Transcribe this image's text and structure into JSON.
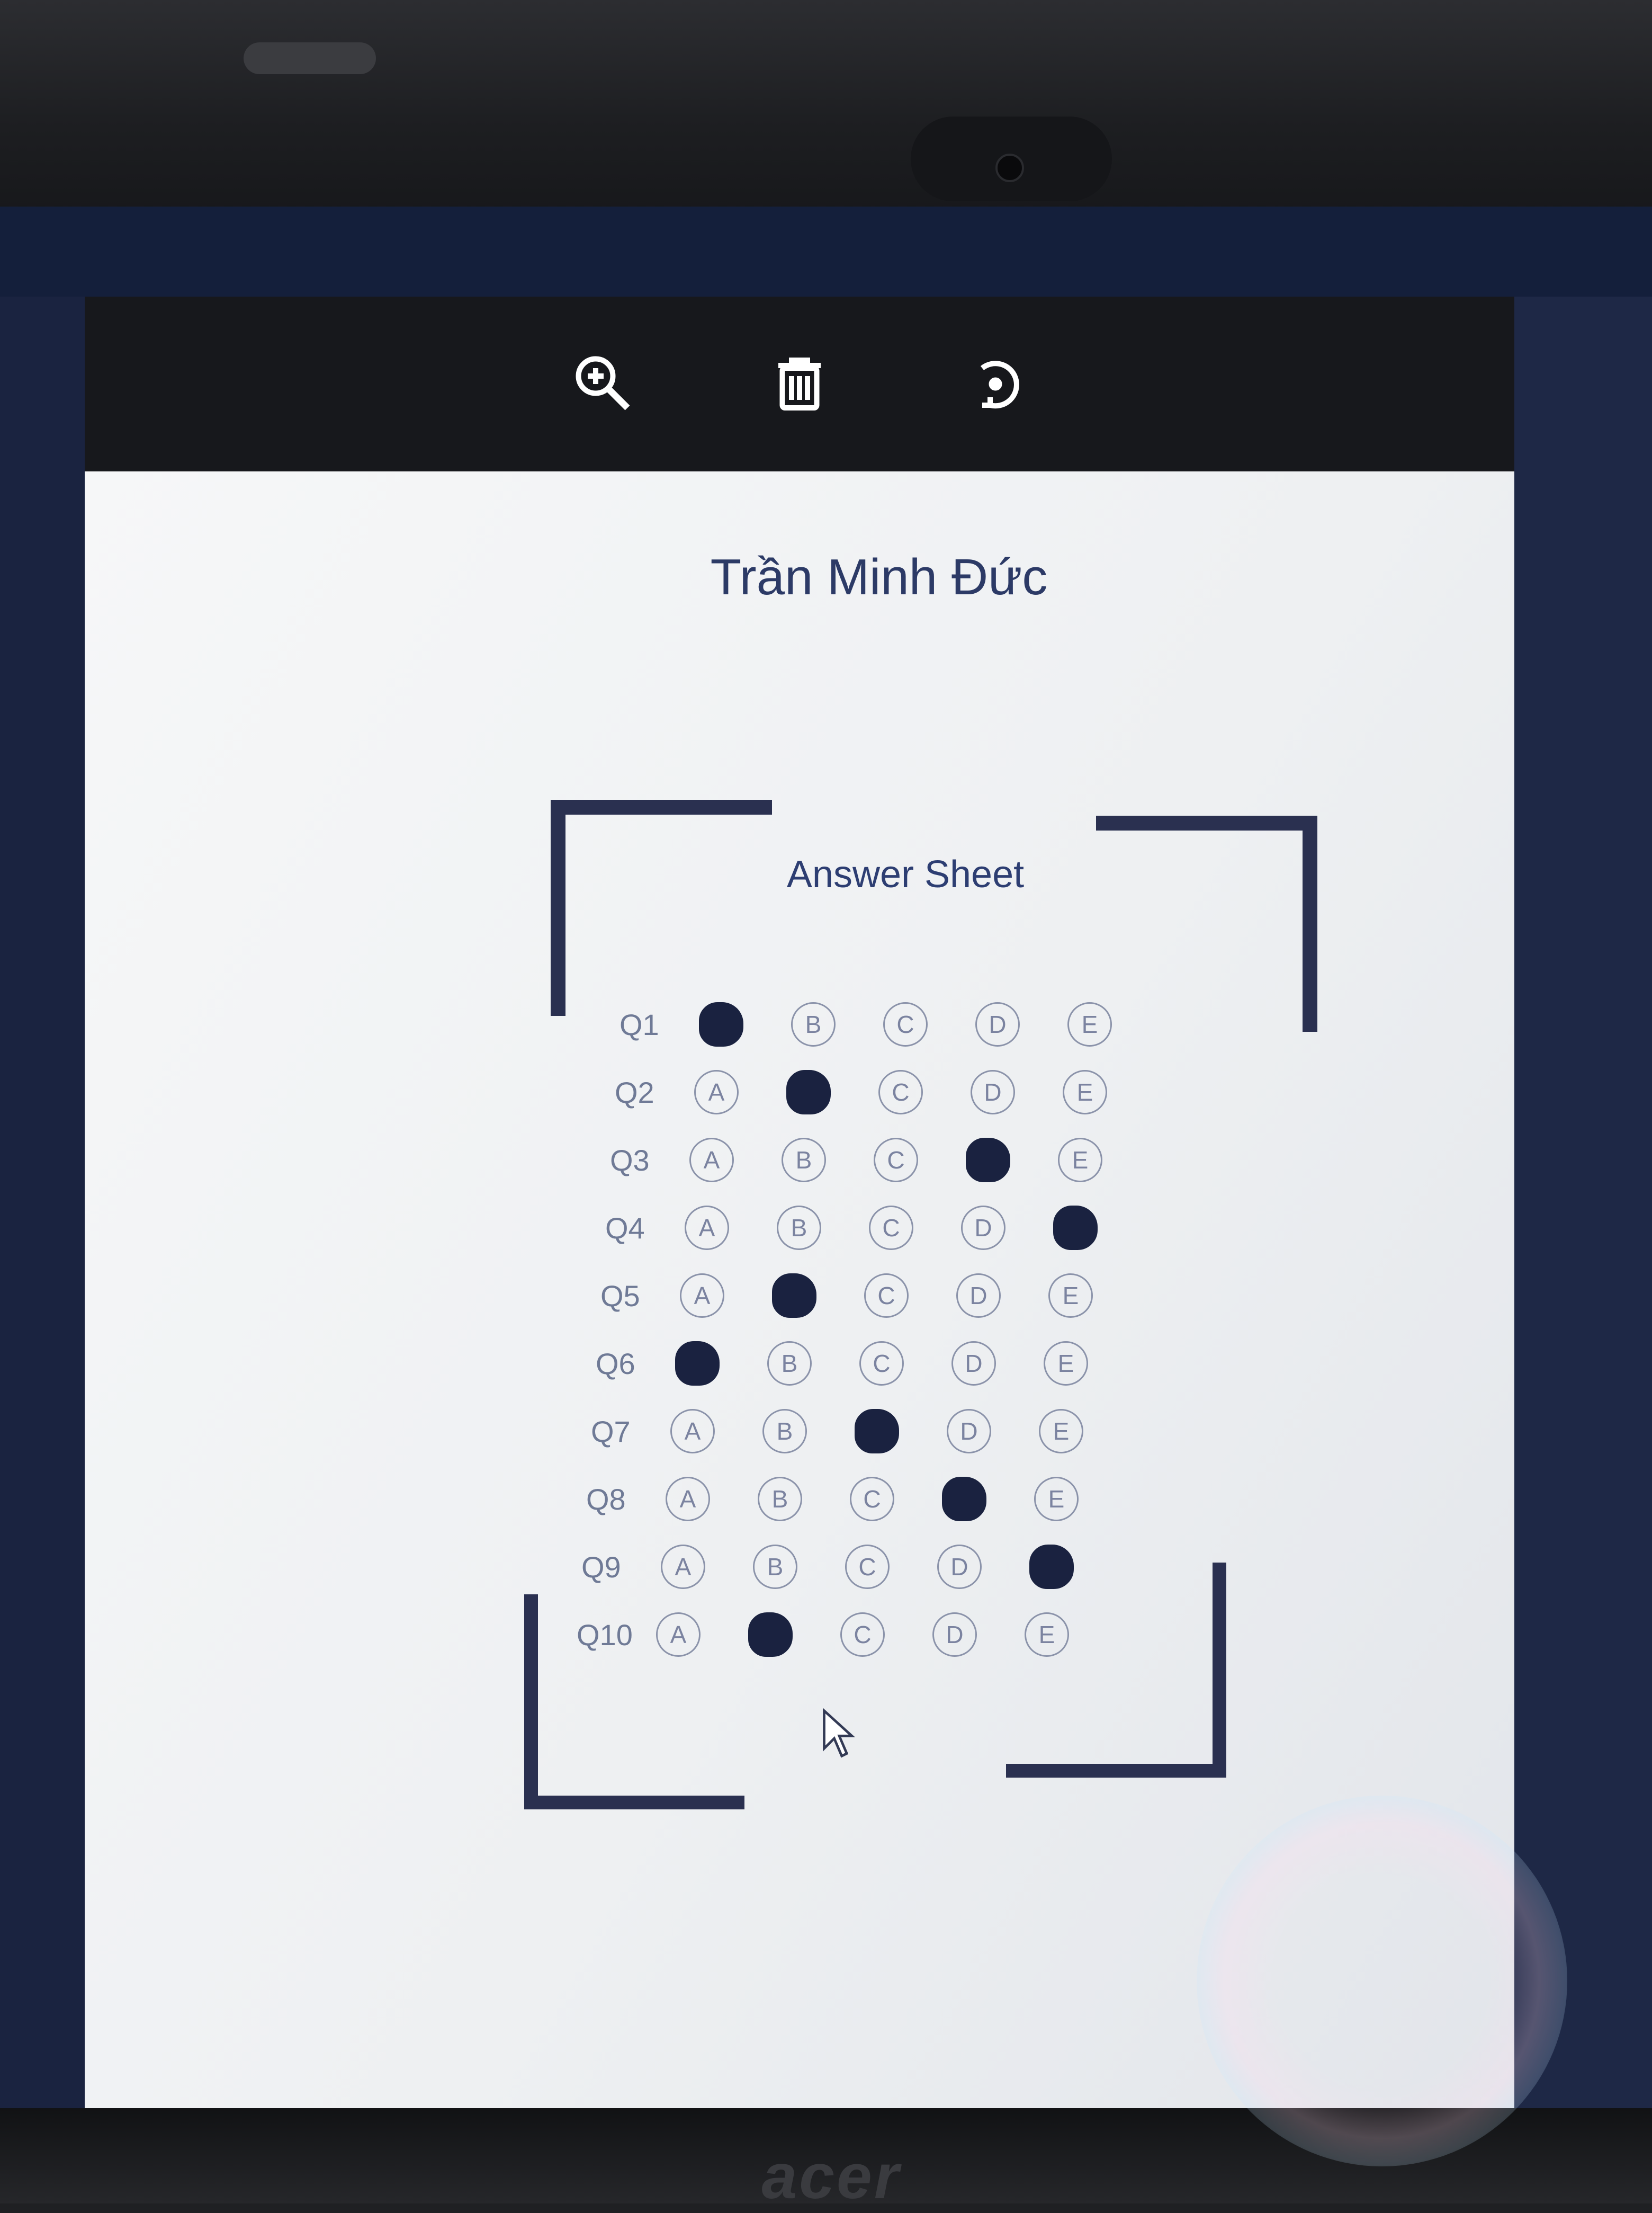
{
  "device": {
    "brand": "acer"
  },
  "toolbar": {
    "buttons": [
      {
        "name": "zoom-in",
        "icon": "zoom-in-icon"
      },
      {
        "name": "delete",
        "icon": "trash-icon"
      },
      {
        "name": "rotate",
        "icon": "rotate-icon"
      }
    ]
  },
  "sheet": {
    "student_name": "Trần Minh Đức",
    "title": "Answer Sheet",
    "options": [
      "A",
      "B",
      "C",
      "D",
      "E"
    ],
    "questions": [
      {
        "label": "Q1",
        "filled": "A"
      },
      {
        "label": "Q2",
        "filled": "B"
      },
      {
        "label": "Q3",
        "filled": "D"
      },
      {
        "label": "Q4",
        "filled": "E"
      },
      {
        "label": "Q5",
        "filled": "B"
      },
      {
        "label": "Q6",
        "filled": "A"
      },
      {
        "label": "Q7",
        "filled": "C"
      },
      {
        "label": "Q8",
        "filled": "D"
      },
      {
        "label": "Q9",
        "filled": "E"
      },
      {
        "label": "Q10",
        "filled": "B"
      }
    ]
  },
  "colors": {
    "ink": "#2c3a66",
    "frame": "#2a3050",
    "filled": "#1a2240"
  }
}
